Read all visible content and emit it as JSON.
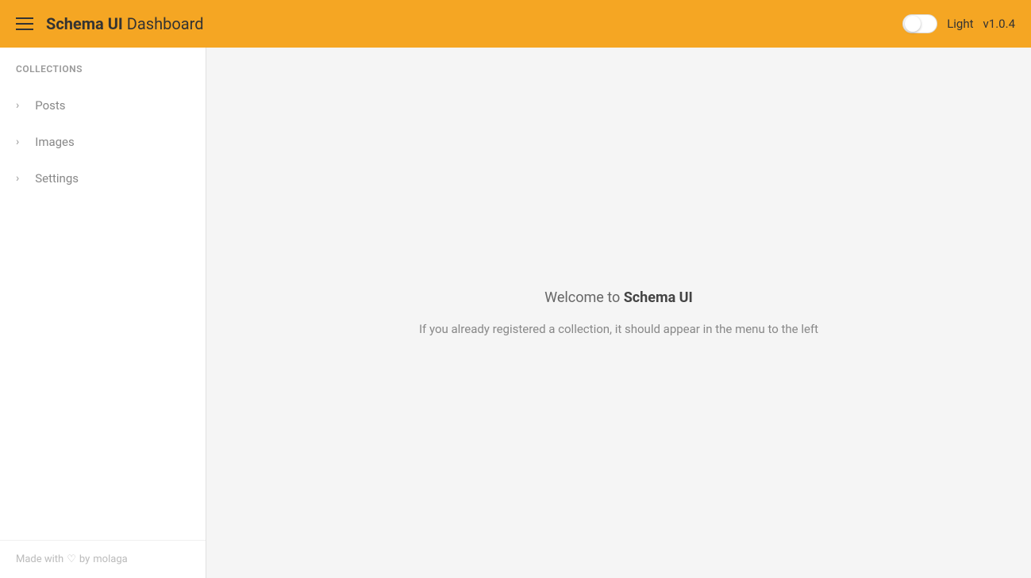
{
  "header": {
    "app_name": "Schema UI",
    "app_subtitle": "Dashboard",
    "light_label": "Light",
    "version": "v1.0.4"
  },
  "sidebar": {
    "collections_label": "COLLECTIONS",
    "items": [
      {
        "label": "Posts"
      },
      {
        "label": "Images"
      },
      {
        "label": "Settings"
      }
    ],
    "footer": {
      "prefix": "Made with",
      "heart": "♡",
      "by": "by",
      "author": "molaga"
    }
  },
  "main": {
    "welcome_line1_prefix": "Welcome to ",
    "welcome_line1_brand": "Schema UI",
    "welcome_line2": "If you already registered a collection, it should appear in the menu to the left"
  },
  "toggle": {
    "active": false
  }
}
